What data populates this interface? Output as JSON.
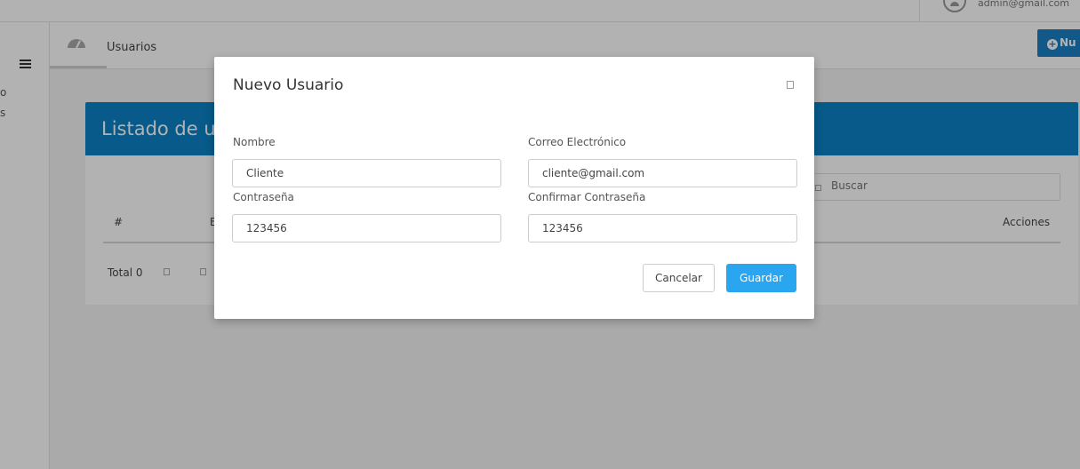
{
  "header": {
    "user_email": "admin@gmail.com"
  },
  "subheader": {
    "breadcrumb": "Usuarios",
    "new_button_label": "Nu"
  },
  "sidebar": {
    "fragment_1": "o",
    "fragment_2": "s"
  },
  "card": {
    "title": "Listado de us",
    "search_placeholder": "Buscar",
    "columns": [
      "#",
      "E",
      "Acciones"
    ],
    "total_label": "Total 0"
  },
  "modal": {
    "title": "Nuevo Usuario",
    "fields": {
      "name": {
        "label": "Nombre",
        "value": "Cliente"
      },
      "email": {
        "label": "Correo Electrónico",
        "value": "cliente@gmail.com"
      },
      "password": {
        "label": "Contraseña",
        "value": "123456"
      },
      "confirm": {
        "label": "Confirmar Contraseña",
        "value": "123456"
      }
    },
    "cancel_label": "Cancelar",
    "save_label": "Guardar"
  },
  "colors": {
    "primary": "#1b7fc4",
    "card_header": "#0b82c4",
    "save_button": "#2aa5f0"
  },
  "icons": [
    "menu-icon",
    "gauge-icon",
    "plus-circle-icon",
    "user-avatar-icon",
    "search-icon",
    "close-icon"
  ]
}
